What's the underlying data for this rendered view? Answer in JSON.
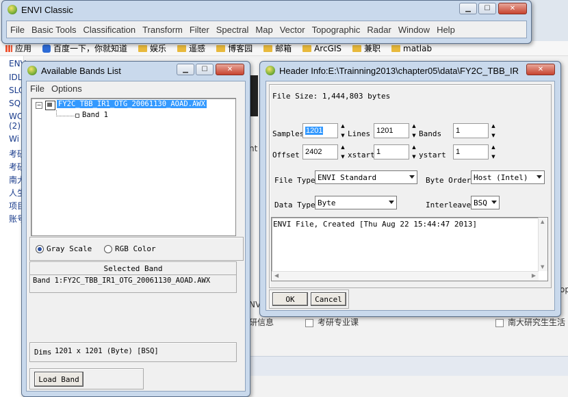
{
  "browser": {
    "bookmarks": [
      {
        "label": "应用",
        "icon": "apps-grid-icon"
      },
      {
        "label": "百度一下，你就知道",
        "icon": "baidu-paw-icon"
      },
      {
        "label": "娱乐",
        "icon": "folder-icon"
      },
      {
        "label": "遥感",
        "icon": "folder-icon"
      },
      {
        "label": "博客园",
        "icon": "folder-icon"
      },
      {
        "label": "邮箱",
        "icon": "folder-icon"
      },
      {
        "label": "ArcGIS",
        "icon": "folder-icon"
      },
      {
        "label": "兼职",
        "icon": "folder-icon"
      },
      {
        "label": "matlab",
        "icon": "folder-icon"
      }
    ],
    "left_items": [
      "ENV",
      "IDL",
      "SLO",
      "SQ",
      "WC",
      "(2)",
      "Wi",
      "考研",
      "考研",
      "南大",
      "人生",
      "项目",
      "账号"
    ],
    "bottom_texts": {
      "a": "研信息",
      "b": "考研专业课",
      "c": "南大研究生生活",
      "d": "NVI",
      "e": "nt",
      "f": "op"
    }
  },
  "envi_main": {
    "title": "ENVI Classic",
    "menu": [
      "File",
      "Basic Tools",
      "Classification",
      "Transform",
      "Filter",
      "Spectral",
      "Map",
      "Vector",
      "Topographic",
      "Radar",
      "Window",
      "Help"
    ]
  },
  "bands_list": {
    "title": "Available Bands List",
    "menu": [
      "File",
      "Options"
    ],
    "file_node": "FY2C_TBB_IR1_OTG_20061130_AOAD.AWX",
    "band_node": "Band 1",
    "radio_gray": "Gray Scale",
    "radio_rgb": "RGB Color",
    "selected_header": "Selected Band",
    "selected_value": "Band 1:FY2C_TBB_IR1_OTG_20061130_AOAD.AWX",
    "dims_label": "Dims",
    "dims_value": "1201 x 1201 (Byte) [BSQ]",
    "load_button": "Load Band"
  },
  "header_info": {
    "title": "Header Info:E:\\Trainning2013\\chapter05\\data\\FY2C_TBB_IR...",
    "file_size": "File Size: 1,444,803 bytes",
    "samples_label": "Samples",
    "samples_value": "1201",
    "lines_label": "Lines",
    "lines_value": "1201",
    "bands_label": "Bands",
    "bands_value": "1",
    "offset_label": "Offset",
    "offset_value": "2402",
    "xstart_label": "xstart",
    "xstart_value": "1",
    "ystart_label": "ystart",
    "ystart_value": "1",
    "file_type_label": "File Type",
    "file_type_value": "ENVI Standard",
    "byte_order_label": "Byte Order",
    "byte_order_value": "Host (Intel)",
    "data_type_label": "Data Type",
    "data_type_value": "Byte",
    "interleave_label": "Interleave",
    "interleave_value": "BSQ",
    "description": "ENVI File, Created [Thu Aug 22 15:44:47 2013]",
    "ok_button": "OK",
    "cancel_button": "Cancel"
  },
  "colors": {
    "selection": "#3399ff",
    "title_bg": "#c9d9ec",
    "close_red": "#c7432f"
  }
}
